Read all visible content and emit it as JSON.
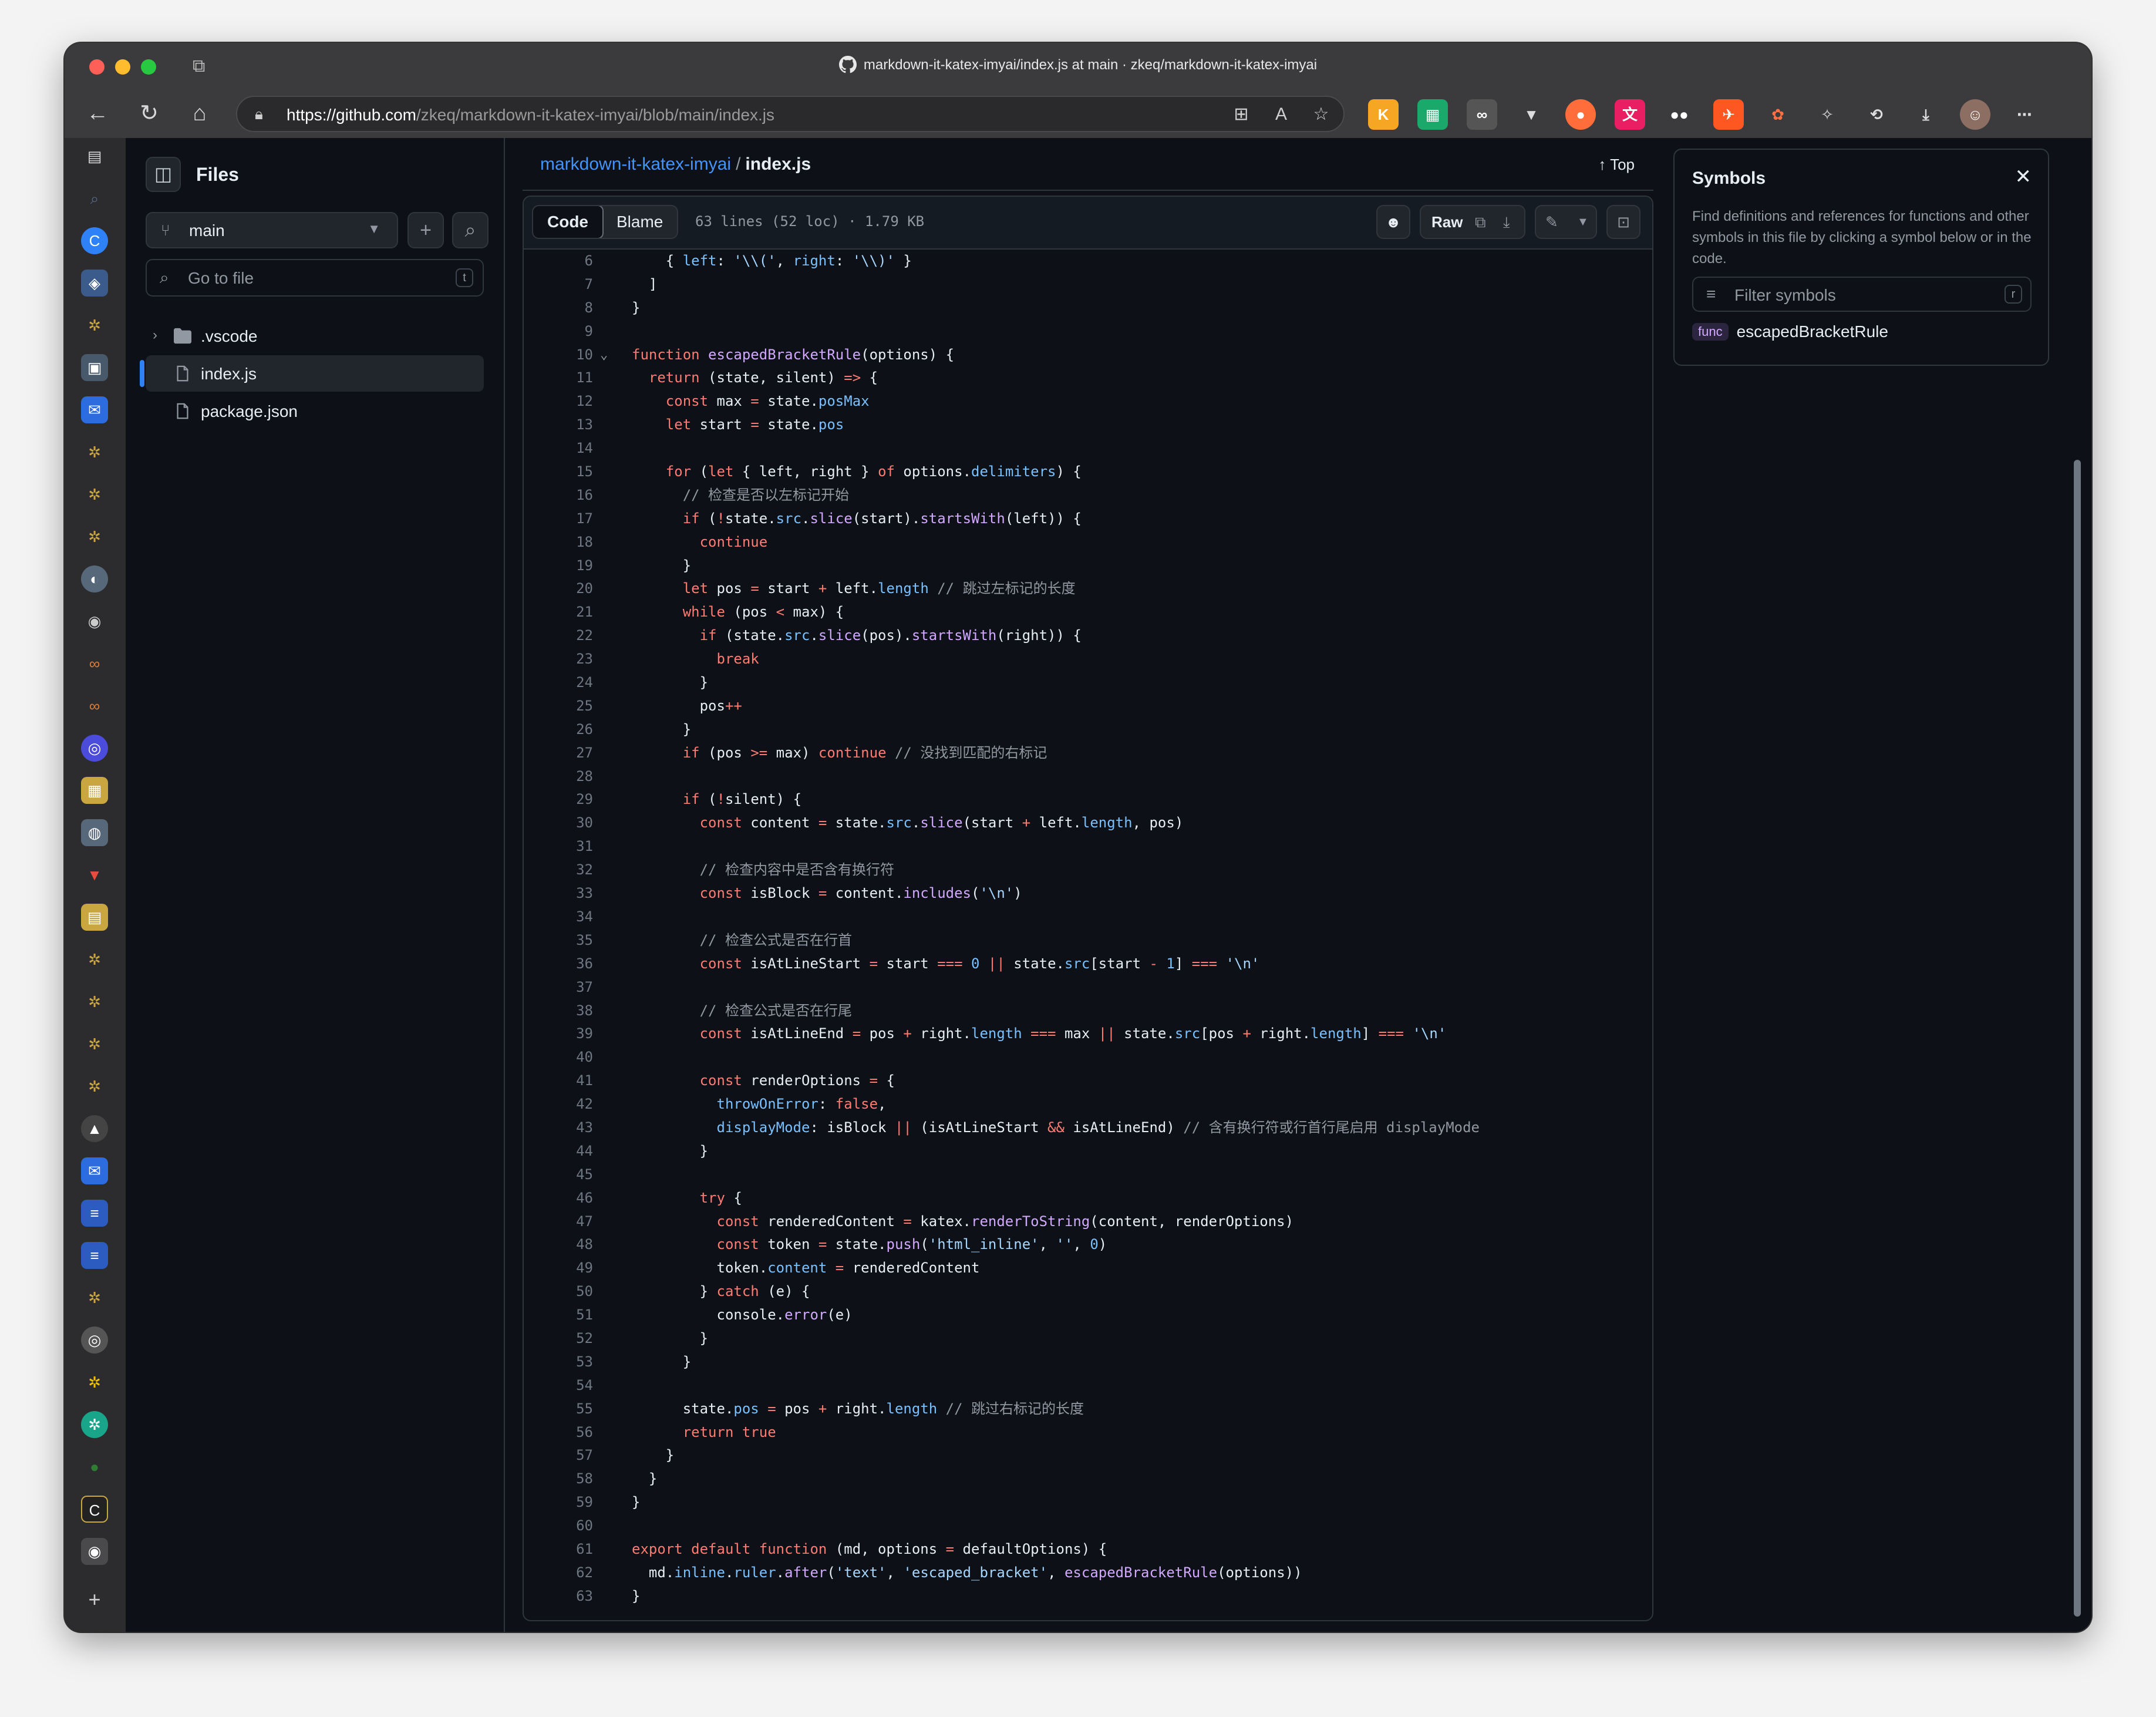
{
  "window": {
    "title": "markdown-it-katex-imyai/index.js at main · zkeq/markdown-it-katex-imyai",
    "url_host": "https://github.com",
    "url_path": "/zkeq/markdown-it-katex-imyai/blob/main/index.js"
  },
  "colors": {
    "accent": "#4493f8",
    "keyword": "#ff7b72",
    "function": "#d2a8ff",
    "property": "#79c0ff",
    "string": "#a5d6ff",
    "comment": "#9198a1"
  },
  "files": {
    "title": "Files",
    "branch": "main",
    "goto_placeholder": "Go to file",
    "goto_shortcut": "t",
    "tree": [
      {
        "label": ".vscode",
        "type": "folder"
      },
      {
        "label": "index.js",
        "type": "file",
        "active": true
      },
      {
        "label": "package.json",
        "type": "file"
      }
    ]
  },
  "code": {
    "breadcrumb_repo": "markdown-it-katex-imyai",
    "breadcrumb_sep": "/",
    "breadcrumb_file": "index.js",
    "top_label": "Top",
    "tab_code": "Code",
    "tab_blame": "Blame",
    "meta": "63 lines (52 loc) · 1.79 KB",
    "raw_label": "Raw",
    "lines": [
      {
        "n": 6,
        "t": "    { left: '\\\\(', right: '\\\\)' }"
      },
      {
        "n": 7,
        "t": "  ]"
      },
      {
        "n": 8,
        "t": "}"
      },
      {
        "n": 9,
        "t": ""
      },
      {
        "n": 10,
        "t": "function escapedBracketRule(options) {",
        "fold": true
      },
      {
        "n": 11,
        "t": "  return (state, silent) => {"
      },
      {
        "n": 12,
        "t": "    const max = state.posMax"
      },
      {
        "n": 13,
        "t": "    let start = state.pos"
      },
      {
        "n": 14,
        "t": ""
      },
      {
        "n": 15,
        "t": "    for (let { left, right } of options.delimiters) {"
      },
      {
        "n": 16,
        "t": "      // 检查是否以左标记开始"
      },
      {
        "n": 17,
        "t": "      if (!state.src.slice(start).startsWith(left)) {"
      },
      {
        "n": 18,
        "t": "        continue"
      },
      {
        "n": 19,
        "t": "      }"
      },
      {
        "n": 20,
        "t": "      let pos = start + left.length // 跳过左标记的长度"
      },
      {
        "n": 21,
        "t": "      while (pos < max) {"
      },
      {
        "n": 22,
        "t": "        if (state.src.slice(pos).startsWith(right)) {"
      },
      {
        "n": 23,
        "t": "          break"
      },
      {
        "n": 24,
        "t": "        }"
      },
      {
        "n": 25,
        "t": "        pos++"
      },
      {
        "n": 26,
        "t": "      }"
      },
      {
        "n": 27,
        "t": "      if (pos >= max) continue // 没找到匹配的右标记"
      },
      {
        "n": 28,
        "t": ""
      },
      {
        "n": 29,
        "t": "      if (!silent) {"
      },
      {
        "n": 30,
        "t": "        const content = state.src.slice(start + left.length, pos)"
      },
      {
        "n": 31,
        "t": ""
      },
      {
        "n": 32,
        "t": "        // 检查内容中是否含有换行符"
      },
      {
        "n": 33,
        "t": "        const isBlock = content.includes('\\n')"
      },
      {
        "n": 34,
        "t": ""
      },
      {
        "n": 35,
        "t": "        // 检查公式是否在行首"
      },
      {
        "n": 36,
        "t": "        const isAtLineStart = start === 0 || state.src[start - 1] === '\\n'"
      },
      {
        "n": 37,
        "t": ""
      },
      {
        "n": 38,
        "t": "        // 检查公式是否在行尾"
      },
      {
        "n": 39,
        "t": "        const isAtLineEnd = pos + right.length === max || state.src[pos + right.length] === '\\n'"
      },
      {
        "n": 40,
        "t": ""
      },
      {
        "n": 41,
        "t": "        const renderOptions = {"
      },
      {
        "n": 42,
        "t": "          throwOnError: false,"
      },
      {
        "n": 43,
        "t": "          displayMode: isBlock || (isAtLineStart && isAtLineEnd) // 含有换行符或行首行尾启用 displayMode"
      },
      {
        "n": 44,
        "t": "        }"
      },
      {
        "n": 45,
        "t": ""
      },
      {
        "n": 46,
        "t": "        try {"
      },
      {
        "n": 47,
        "t": "          const renderedContent = katex.renderToString(content, renderOptions)"
      },
      {
        "n": 48,
        "t": "          const token = state.push('html_inline', '', 0)"
      },
      {
        "n": 49,
        "t": "          token.content = renderedContent"
      },
      {
        "n": 50,
        "t": "        } catch (e) {"
      },
      {
        "n": 51,
        "t": "          console.error(e)"
      },
      {
        "n": 52,
        "t": "        }"
      },
      {
        "n": 53,
        "t": "      }"
      },
      {
        "n": 54,
        "t": ""
      },
      {
        "n": 55,
        "t": "      state.pos = pos + right.length // 跳过右标记的长度"
      },
      {
        "n": 56,
        "t": "      return true"
      },
      {
        "n": 57,
        "t": "    }"
      },
      {
        "n": 58,
        "t": "  }"
      },
      {
        "n": 59,
        "t": "}"
      },
      {
        "n": 60,
        "t": ""
      },
      {
        "n": 61,
        "t": "export default function (md, options = defaultOptions) {"
      },
      {
        "n": 62,
        "t": "  md.inline.ruler.after('text', 'escaped_bracket', escapedBracketRule(options))"
      },
      {
        "n": 63,
        "t": "}"
      }
    ]
  },
  "symbols": {
    "title": "Symbols",
    "description": "Find definitions and references for functions and other symbols in this file by clicking a symbol below or in the code.",
    "filter_placeholder": "Filter symbols",
    "filter_shortcut": "r",
    "items": [
      {
        "kind": "func",
        "name": "escapedBracketRule"
      }
    ]
  }
}
